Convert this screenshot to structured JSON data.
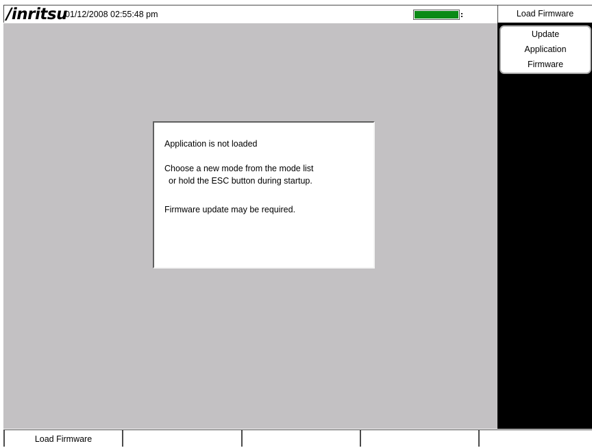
{
  "status_bar": {
    "brand": "/inritsu",
    "datetime": "01/12/2008 02:55:48 pm",
    "battery_level": 1.0,
    "battery_color": "#0b8a16"
  },
  "dialog": {
    "line1": "Application is not loaded",
    "line2": "Choose a new mode from the mode list",
    "line3": "or hold the ESC button during startup.",
    "line4": "Firmware update may be required."
  },
  "side_menu": {
    "title": "Load Firmware",
    "softkey": {
      "line1": "Update",
      "line2": "Application",
      "line3": "Firmware"
    }
  },
  "bottom_bar": {
    "buttons": [
      "Load Firmware",
      "",
      "",
      "",
      ""
    ]
  }
}
